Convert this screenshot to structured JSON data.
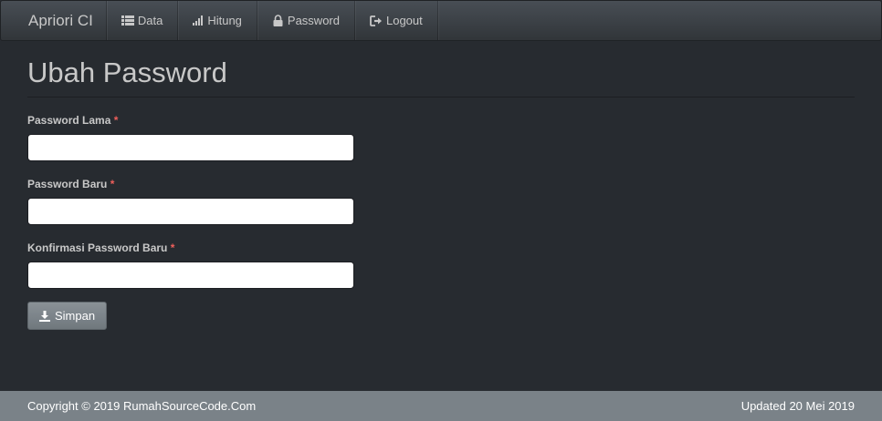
{
  "navbar": {
    "brand": "Apriori CI",
    "items": [
      {
        "label": "Data",
        "icon": "list-icon"
      },
      {
        "label": "Hitung",
        "icon": "signal-icon"
      },
      {
        "label": "Password",
        "icon": "lock-icon"
      },
      {
        "label": "Logout",
        "icon": "logout-icon"
      }
    ]
  },
  "page": {
    "title": "Ubah Password"
  },
  "form": {
    "old_password": {
      "label": "Password Lama",
      "required": "*",
      "value": ""
    },
    "new_password": {
      "label": "Password Baru",
      "required": "*",
      "value": ""
    },
    "confirm_password": {
      "label": "Konfirmasi Password Baru",
      "required": "*",
      "value": ""
    },
    "submit_label": "Simpan",
    "submit_icon": "download-icon"
  },
  "footer": {
    "copyright": "Copyright © 2019 RumahSourceCode.Com",
    "updated": "Updated 20 Mei 2019"
  },
  "colors": {
    "background": "#272b30",
    "navbar": "#3a3f44",
    "footer": "#7a8288",
    "required": "#ee5f5b",
    "text": "#c8c8c8"
  }
}
